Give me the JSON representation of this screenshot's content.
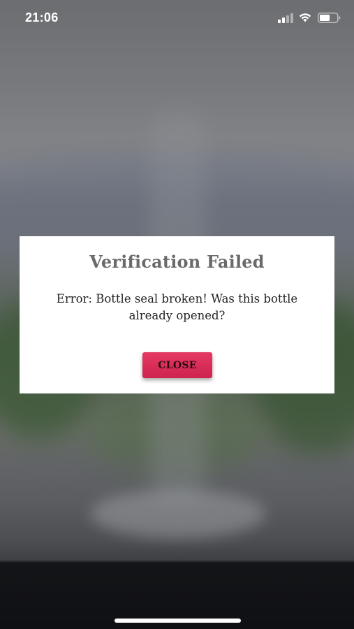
{
  "status_bar": {
    "time": "21:06",
    "icons": [
      "signal-icon",
      "wifi-icon",
      "battery-icon"
    ],
    "battery_level": 0.6
  },
  "dialog": {
    "title": "Verification Failed",
    "message": "Error: Bottle seal broken! Was this bottle already opened?",
    "close_label": "CLOSE"
  },
  "colors": {
    "button_accent": "#d92b57",
    "title_text": "#6a6a6a",
    "message_text": "#222222"
  }
}
